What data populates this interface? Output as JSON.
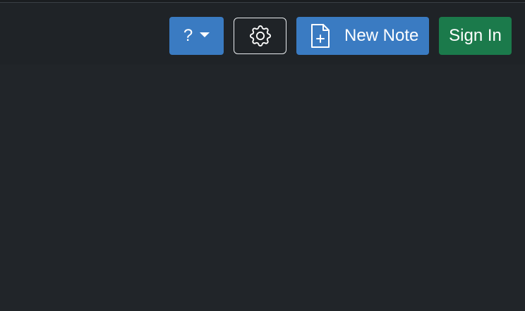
{
  "navbar": {
    "help_label": "?",
    "new_note_label": "New Note",
    "sign_in_label": "Sign In"
  },
  "icons": {
    "help_dropdown": "caret-down-icon",
    "settings": "gear-icon",
    "new_note": "file-plus-icon"
  },
  "colors": {
    "background": "#212529",
    "navbar": "#1f2327",
    "primary": "#3a7bc2",
    "success": "#1b7a4b"
  }
}
